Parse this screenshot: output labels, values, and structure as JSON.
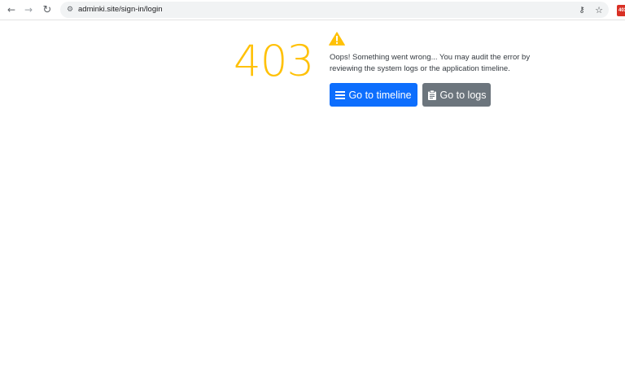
{
  "browser": {
    "url": "adminki.site/sign-in/login",
    "extension_badge": "403"
  },
  "error": {
    "code": "403",
    "message": "Oops! Something went wrong... You may audit the error by reviewing the system logs or the application timeline.",
    "accent_color": "#ffc107"
  },
  "actions": {
    "timeline_label": "Go to timeline",
    "logs_label": "Go to logs",
    "timeline_color": "#0d6efd",
    "logs_color": "#6c757d"
  },
  "icons": {
    "back": "arrow-left-icon",
    "forward": "arrow-right-icon",
    "reload": "reload-icon",
    "site_info": "tune-icon",
    "passwords": "key-icon",
    "bookmark": "star-icon",
    "warning": "warning-triangle-icon",
    "timeline": "list-icon",
    "logs": "clipboard-icon"
  }
}
